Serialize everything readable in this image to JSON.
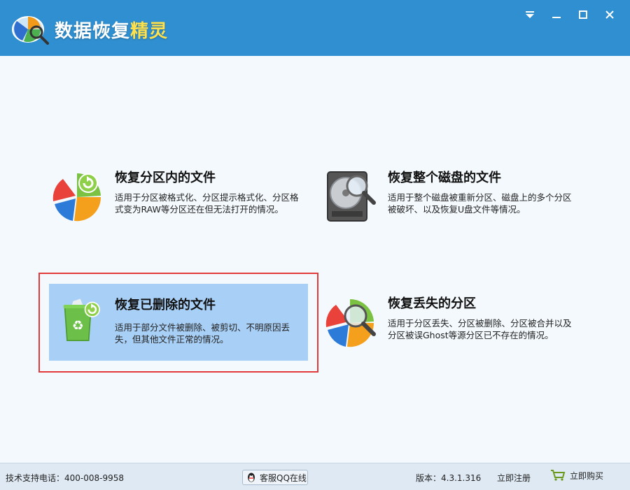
{
  "app": {
    "title_main": "数据恢复",
    "title_accent": "精灵"
  },
  "window_controls": [
    "menu-icon",
    "minimize-icon",
    "maximize-icon",
    "close-icon"
  ],
  "options": [
    {
      "title": "恢复分区内的文件",
      "desc": "适用于分区被格式化、分区提示格式化、分区格式变为RAW等分区还在但无法打开的情况。",
      "icon": "pie-chart-restore-icon"
    },
    {
      "title": "恢复整个磁盘的文件",
      "desc": "适用于整个磁盘被重新分区、磁盘上的多个分区被破坏、以及恢复U盘文件等情况。",
      "icon": "hard-disk-search-icon"
    },
    {
      "title": "恢复已删除的文件",
      "desc": "适用于部分文件被删除、被剪切、不明原因丢失，但其他文件正常的情况。",
      "icon": "recycle-bin-restore-icon"
    },
    {
      "title": "恢复丢失的分区",
      "desc": "适用于分区丢失、分区被删除、分区被合并以及分区被误Ghost等源分区已不存在的情况。",
      "icon": "pie-chart-search-icon"
    }
  ],
  "status": {
    "support": "技术支持电话：400-008-9958",
    "qq_label": "客服QQ在线",
    "version": "版本：4.3.1.316",
    "register": "立即注册",
    "buy": "立即购买"
  },
  "colors": {
    "titlebar": "#2f8fd0",
    "selected_bg": "#a8cff5",
    "highlight_border": "#e23a3a",
    "accent": "#ffe14d"
  }
}
